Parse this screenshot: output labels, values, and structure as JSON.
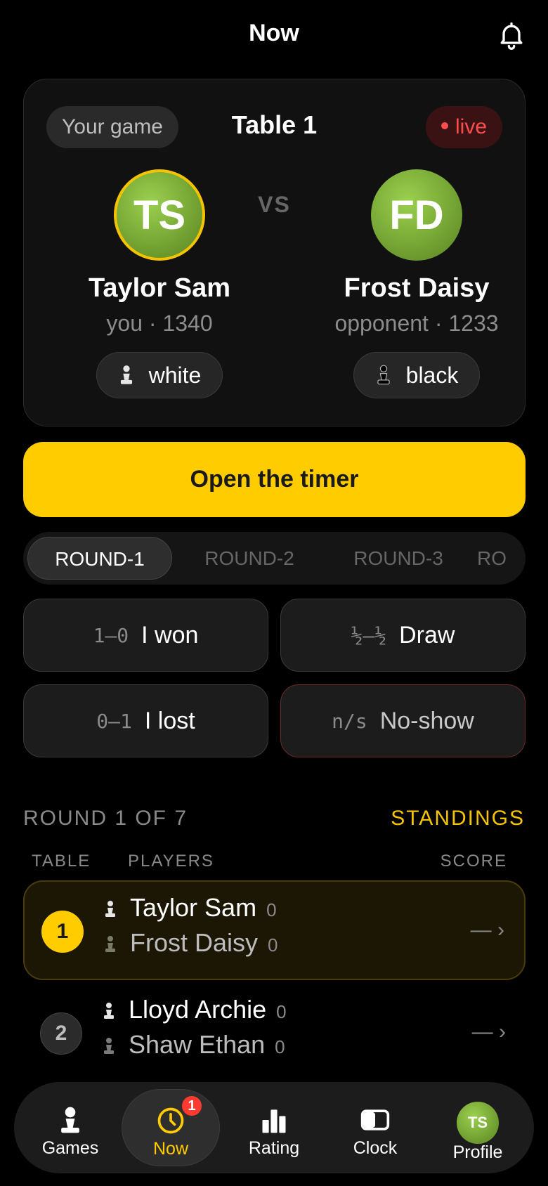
{
  "header": {
    "title": "Now"
  },
  "game_card": {
    "your_game_label": "Your game",
    "table_title": "Table 1",
    "live_label": "live",
    "vs_label": "VS",
    "player_left": {
      "initials": "TS",
      "name": "Taylor Sam",
      "meta": "you · 1340",
      "color_label": "white"
    },
    "player_right": {
      "initials": "FD",
      "name": "Frost Daisy",
      "meta": "opponent · 1233",
      "color_label": "black"
    }
  },
  "timer_button": {
    "label": "Open the timer"
  },
  "rounds": {
    "tabs": [
      "ROUND-1",
      "ROUND-2",
      "ROUND-3",
      "RO"
    ],
    "active": "ROUND-1"
  },
  "results": {
    "won": {
      "code": "1–0",
      "label": "I won"
    },
    "draw": {
      "code": "½–½",
      "label": "Draw"
    },
    "lost": {
      "code": "0–1",
      "label": "I lost"
    },
    "noshow": {
      "code": "n/s",
      "label": "No-show"
    }
  },
  "pairings": {
    "round_label": "ROUND 1 OF 7",
    "standings_link": "STANDINGS",
    "columns": {
      "table": "TABLE",
      "players": "PLAYERS",
      "score": "SCORE"
    },
    "rows": [
      {
        "table": "1",
        "white": "Taylor Sam",
        "white_score": "0",
        "black": "Frost Daisy",
        "black_score": "0",
        "score": "— ›"
      },
      {
        "table": "2",
        "white": "Lloyd Archie",
        "white_score": "0",
        "black": "Shaw Ethan",
        "black_score": "0",
        "score": "— ›"
      }
    ]
  },
  "nav": {
    "games": "Games",
    "now": "Now",
    "now_badge": "1",
    "rating": "Rating",
    "clock": "Clock",
    "profile": "Profile",
    "profile_initials": "TS"
  },
  "colors": {
    "accent": "#ffcc00",
    "live": "#ff4d4d",
    "avatar_green": "#7fb13a"
  }
}
